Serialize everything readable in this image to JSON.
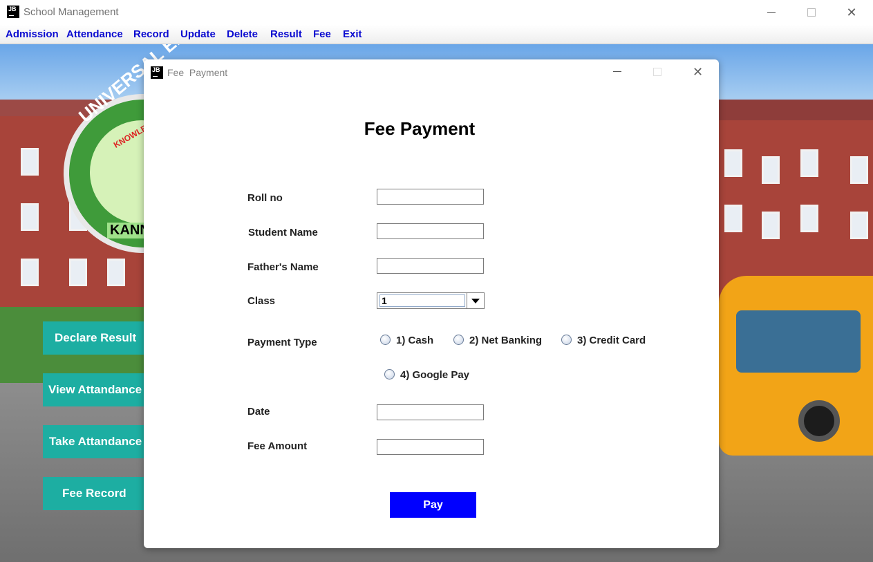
{
  "app": {
    "title": "School Management",
    "logo": "JB"
  },
  "menu": [
    "Admission",
    "Attendance",
    "Record",
    "Update",
    "Delete",
    "Result",
    "Fee",
    "Exit"
  ],
  "background": {
    "logo_text": "UNIVERSAL ENG",
    "logo_subtext": "KNOWLEDGE",
    "logo_banner": "KANN"
  },
  "side_buttons": [
    "Declare Result",
    "View Attandance",
    "Take Attandance",
    "Fee Record"
  ],
  "dialog": {
    "logo": "JB",
    "title": "Fee  Payment",
    "heading": "Fee Payment",
    "labels": {
      "roll_no": "Roll no",
      "student_name": "Student Name",
      "fathers_name": "Father's Name",
      "class": "Class",
      "payment_type": "Payment Type",
      "date": "Date",
      "fee_amount": "Fee Amount"
    },
    "values": {
      "roll_no": "",
      "student_name": "",
      "fathers_name": "",
      "class": "1",
      "date": "",
      "fee_amount": ""
    },
    "payment_options": [
      "1) Cash",
      "2) Net Banking",
      "3) Credit Card",
      "4) Google Pay"
    ],
    "pay_button": "Pay"
  },
  "colors": {
    "menu_text": "#0a0ad0",
    "side_button": "#1daea2",
    "pay_button": "#0000ff"
  }
}
